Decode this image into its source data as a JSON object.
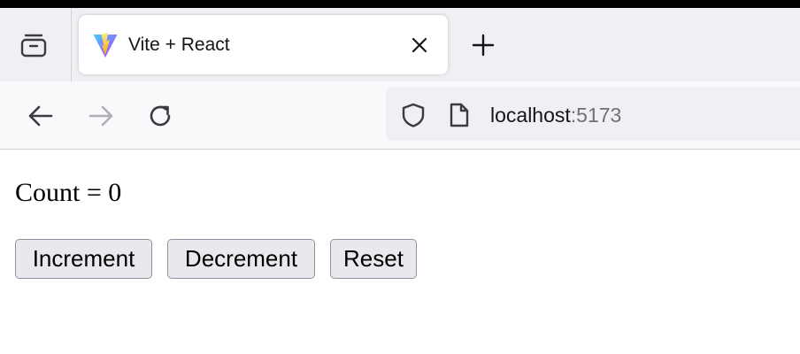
{
  "browser": {
    "tab": {
      "title": "Vite + React",
      "favicon": "vite-logo-icon"
    },
    "nav": {
      "back": "back-arrow-icon",
      "forward": "forward-arrow-icon",
      "reload": "reload-icon"
    },
    "url": {
      "host": "localhost",
      "port": ":5173"
    },
    "colors": {
      "tabbar_bg": "#f0f0f4",
      "navbar_bg": "#f9f9fb",
      "urlbar_bg": "#f0f0f4"
    }
  },
  "page": {
    "count_text": "Count = 0",
    "buttons": {
      "increment": "Increment",
      "decrement": "Decrement",
      "reset": "Reset"
    },
    "colors": {
      "button_bg": "#e9e9ed",
      "button_border": "#8f8f9d"
    }
  }
}
